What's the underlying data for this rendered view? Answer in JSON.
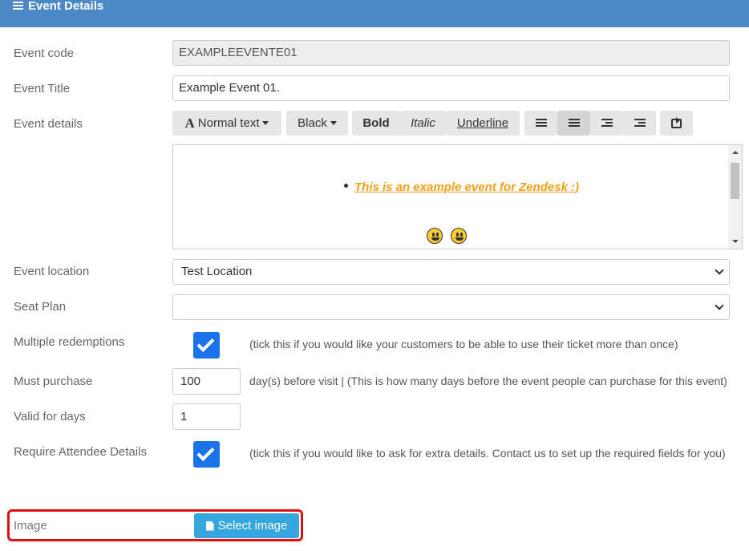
{
  "header": {
    "title": "Event Details",
    "icon": "hamburger-icon"
  },
  "fields": {
    "event_code": {
      "label": "Event code",
      "value": "EXAMPLEEVENTE01"
    },
    "event_title": {
      "label": "Event Title",
      "value": "Example Event 01."
    },
    "event_details": {
      "label": "Event details"
    },
    "event_location": {
      "label": "Event location",
      "value": "Test Location"
    },
    "seat_plan": {
      "label": "Seat Plan",
      "value": ""
    },
    "multiple_redemptions": {
      "label": "Multiple redemptions",
      "checked": true,
      "note": "(tick this if you would like your customers to be able to use their ticket more than once)"
    },
    "must_purchase": {
      "label": "Must purchase",
      "value": "100",
      "note": "day(s) before visit | (This is how many days before the event people can purchase for this event)"
    },
    "valid_for_days": {
      "label": "Valid for days",
      "value": "1"
    },
    "require_attendee_details": {
      "label": "Require Attendee Details",
      "checked": true,
      "note": "(tick this if you would like to ask for extra details. Contact us to set up the required fields for you)"
    },
    "image": {
      "label": "Image",
      "button": "Select image"
    }
  },
  "toolbar": {
    "format": "Normal text",
    "color": "Black",
    "bold": "Bold",
    "italic": "Italic",
    "underline": "Underline"
  },
  "editor": {
    "content": "This is an example event for Zendesk :)",
    "text_color": "#f0a01a",
    "emoji_count": 2
  },
  "colors": {
    "header": "#4a89c5",
    "checkbox": "#1a73e8",
    "button": "#35a6de",
    "highlight_border": "#e01010"
  }
}
